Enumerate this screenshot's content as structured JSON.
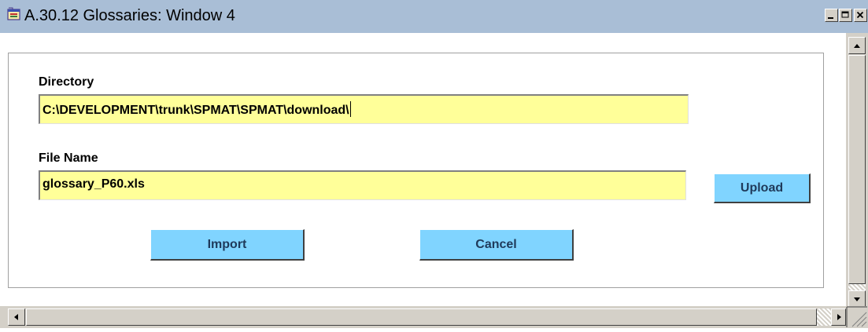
{
  "window": {
    "title": "A.30.12 Glossaries: Window 4",
    "app_icon": "app-form-icon",
    "controls": [
      "minimize-icon",
      "maximize-icon",
      "close-icon"
    ]
  },
  "form": {
    "directory_label": "Directory",
    "directory_value": "C:\\DEVELOPMENT\\trunk\\SPMAT\\SPMAT\\download\\",
    "filename_label": "File Name",
    "filename_value": "glossary_P60.xls",
    "upload_label": "Upload",
    "import_label": "Import",
    "cancel_label": "Cancel"
  },
  "colors": {
    "titlebar": "#a9bed6",
    "field_background": "#ffff99",
    "button_background": "#80d4ff",
    "button_text": "#1f3a5a"
  }
}
